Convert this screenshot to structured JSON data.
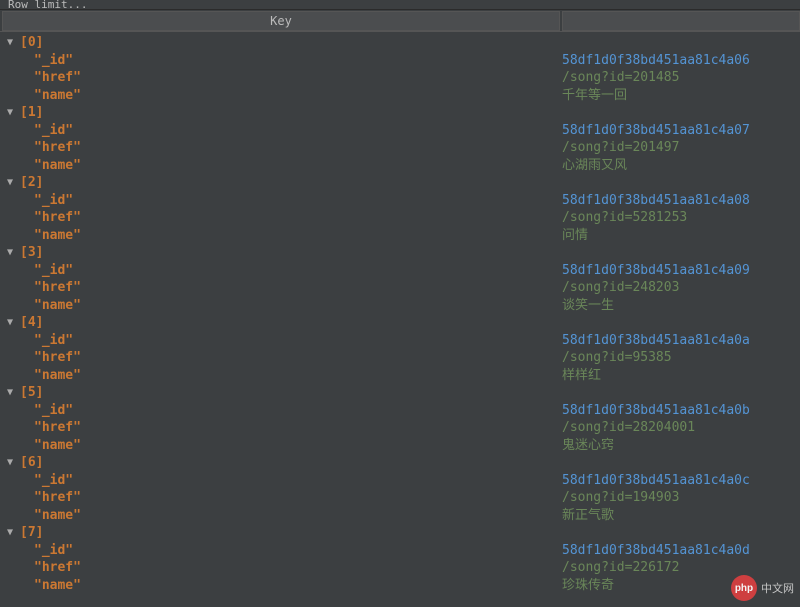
{
  "toolbar": {
    "label_fragment": "Row limit..."
  },
  "header": {
    "key_label": "Key"
  },
  "fields": {
    "id": "\"_id\"",
    "href": "\"href\"",
    "name": "\"name\""
  },
  "rows": [
    {
      "index": "[0]",
      "id": "58df1d0f38bd451aa81c4a06",
      "href": "/song?id=201485",
      "name": "千年等一回"
    },
    {
      "index": "[1]",
      "id": "58df1d0f38bd451aa81c4a07",
      "href": "/song?id=201497",
      "name": "心湖雨又风"
    },
    {
      "index": "[2]",
      "id": "58df1d0f38bd451aa81c4a08",
      "href": "/song?id=5281253",
      "name": "问情"
    },
    {
      "index": "[3]",
      "id": "58df1d0f38bd451aa81c4a09",
      "href": "/song?id=248203",
      "name": "谈笑一生"
    },
    {
      "index": "[4]",
      "id": "58df1d0f38bd451aa81c4a0a",
      "href": "/song?id=95385",
      "name": "样样红"
    },
    {
      "index": "[5]",
      "id": "58df1d0f38bd451aa81c4a0b",
      "href": "/song?id=28204001",
      "name": "鬼迷心窍"
    },
    {
      "index": "[6]",
      "id": "58df1d0f38bd451aa81c4a0c",
      "href": "/song?id=194903",
      "name": "新正气歌"
    },
    {
      "index": "[7]",
      "id": "58df1d0f38bd451aa81c4a0d",
      "href": "/song?id=226172",
      "name": "珍珠传奇"
    }
  ],
  "watermark": {
    "badge": "php",
    "text": "中文网"
  }
}
